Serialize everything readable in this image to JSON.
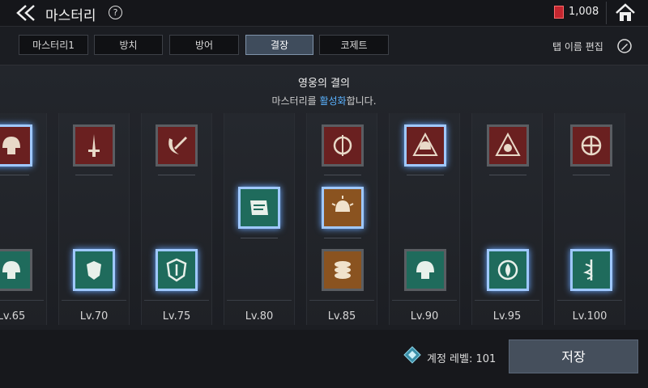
{
  "header": {
    "title": "마스터리",
    "help": "?",
    "gem_count": "1,008"
  },
  "tabs": [
    {
      "label": "마스터리1"
    },
    {
      "label": "방치"
    },
    {
      "label": "방어"
    },
    {
      "label": "결장",
      "active": true
    },
    {
      "label": "코제트"
    }
  ],
  "edit_tab_label": "탭 이름 편집",
  "section": {
    "title": "영웅의 결의",
    "subtitle_pre": "마스터리를 ",
    "subtitle_hl": "활성화",
    "subtitle_post": "합니다."
  },
  "columns": [
    {
      "level": "Lv.65"
    },
    {
      "level": "Lv.70"
    },
    {
      "level": "Lv.75"
    },
    {
      "level": "Lv.80"
    },
    {
      "level": "Lv.85"
    },
    {
      "level": "Lv.90"
    },
    {
      "level": "Lv.95"
    },
    {
      "level": "Lv.100"
    }
  ],
  "footer": {
    "account_level_label": "계정 레벨: 101",
    "save_label": "저장"
  },
  "colors": {
    "accent_blue": "#5ab2ff",
    "red_slot": "#6a2020",
    "green_slot": "#1f6b5c",
    "orange_slot": "#8a5320"
  }
}
